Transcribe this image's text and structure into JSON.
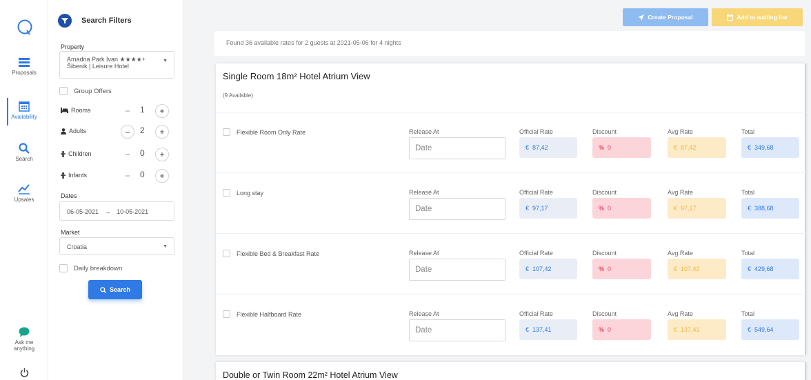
{
  "nav": {
    "items": [
      {
        "label": "Proposals",
        "icon": "proposals-icon"
      },
      {
        "label": "Availability",
        "icon": "calendar-icon",
        "active": true
      },
      {
        "label": "Search",
        "icon": "search-icon"
      },
      {
        "label": "Upsales",
        "icon": "chart-icon"
      }
    ],
    "ask_label_line1": "Ask me",
    "ask_label_line2": "anything"
  },
  "filters": {
    "title": "Search Filters",
    "property_label": "Property",
    "property_line1": "Amadria Park Ivan ★★★★+",
    "property_line2": "Šibenik | Leisure Hotel",
    "group_offers": "Group Offers",
    "rooms": {
      "label": "Rooms",
      "value": "1"
    },
    "adults": {
      "label": "Adults",
      "value": "2"
    },
    "children": {
      "label": "Children",
      "value": "0"
    },
    "infants": {
      "label": "Infants",
      "value": "0"
    },
    "dates_label": "Dates",
    "date_from": "06-05-2021",
    "date_arrow": "→",
    "date_to": "10-05-2021",
    "market_label": "Market",
    "market_value": "Croatia",
    "daily_breakdown": "Daily breakdown",
    "search_button": "Search"
  },
  "toolbar": {
    "create_proposal": "Create Proposal",
    "add_waiting": "Add to waiting list"
  },
  "found_text": "Found 36 available rates for 2 guests at 2021-05-06 for 4 nights",
  "columns": {
    "release": "Release At",
    "official": "Official Rate",
    "discount": "Discount",
    "avg": "Avg Rate",
    "total": "Total",
    "date_placeholder": "Date",
    "currency": "€",
    "percent": "%"
  },
  "room1": {
    "title": "Single Room 18m² Hotel Atrium View",
    "available": "(9 Available)",
    "rates": [
      {
        "name": "Flexible Room Only Rate",
        "official": "87,42",
        "discount": "0",
        "avg": "87,42",
        "total": "349,68"
      },
      {
        "name": "Long stay",
        "official": "97,17",
        "discount": "0",
        "avg": "97,17",
        "total": "388,68"
      },
      {
        "name": "Flexible Bed & Breakfast Rate",
        "official": "107,42",
        "discount": "0",
        "avg": "107,42",
        "total": "429,68"
      },
      {
        "name": "Flexible Halfboard Rate",
        "official": "137,41",
        "discount": "0",
        "avg": "137,41",
        "total": "549,64"
      }
    ]
  },
  "room2": {
    "title": "Double or Twin Room 22m² Hotel Atrium View"
  },
  "colors": {
    "accent": "#2f7ae5",
    "discount": "#ee4b68",
    "avg": "#f2b441",
    "chat": "#17a589"
  }
}
